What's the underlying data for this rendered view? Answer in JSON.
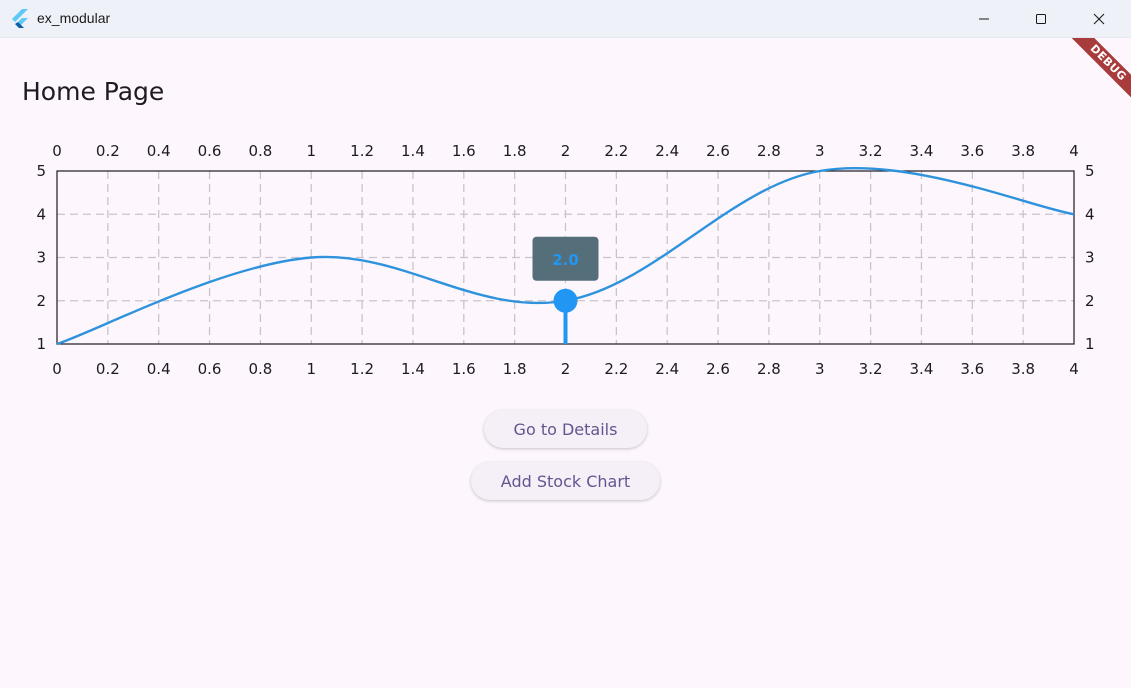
{
  "window": {
    "title": "ex_modular",
    "minimize_icon": "minimize-icon",
    "maximize_icon": "maximize-icon",
    "close_icon": "close-icon"
  },
  "page": {
    "title": "Home Page",
    "debug_label": "DEBUG"
  },
  "buttons": {
    "details_label": "Go to Details",
    "stock_label": "Add Stock Chart"
  },
  "colors": {
    "line": "#2f92dd",
    "indicator": "#2196f3",
    "tooltip_bg": "#546e7a",
    "tooltip_text": "#2196f3",
    "button_text": "#65558f",
    "background": "#fdf7fd"
  },
  "chart_data": {
    "type": "line",
    "x": [
      0,
      1,
      2,
      3,
      4
    ],
    "series": [
      {
        "values": [
          1,
          3,
          2,
          5,
          4
        ]
      }
    ],
    "x_ticks": [
      "0",
      "0.2",
      "0.4",
      "0.6",
      "0.8",
      "1",
      "1.2",
      "1.4",
      "1.6",
      "1.8",
      "2",
      "2.2",
      "2.4",
      "2.6",
      "2.8",
      "3",
      "3.2",
      "3.4",
      "3.6",
      "3.8",
      "4"
    ],
    "y_ticks": [
      "1",
      "2",
      "3",
      "4",
      "5"
    ],
    "xlim": [
      0,
      4
    ],
    "ylim": [
      1,
      5
    ],
    "grid": true,
    "curved": true,
    "axis_labels_top": true,
    "axis_labels_bottom": true,
    "axis_labels_left": true,
    "axis_labels_right": true,
    "touched_point": {
      "x": 2,
      "y": 2,
      "label": "2.0"
    }
  }
}
